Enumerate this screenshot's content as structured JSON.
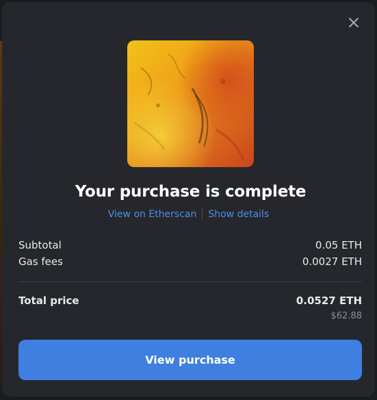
{
  "modal": {
    "title": "Your purchase is complete",
    "links": {
      "etherscan": "View on Etherscan",
      "details": "Show details"
    },
    "summary": {
      "subtotal_label": "Subtotal",
      "subtotal_value": "0.05 ETH",
      "gas_label": "Gas fees",
      "gas_value": "0.0027 ETH",
      "total_label": "Total price",
      "total_value": "0.0527 ETH",
      "total_usd": "$62.88"
    },
    "primary_button": "View purchase",
    "close_icon": "close-icon",
    "artwork_icon": "abstract-painting-image"
  },
  "colors": {
    "modal_bg": "#25272c",
    "accent": "#3f7fe0",
    "link": "#4c8fe6",
    "muted": "#8b8e95"
  }
}
